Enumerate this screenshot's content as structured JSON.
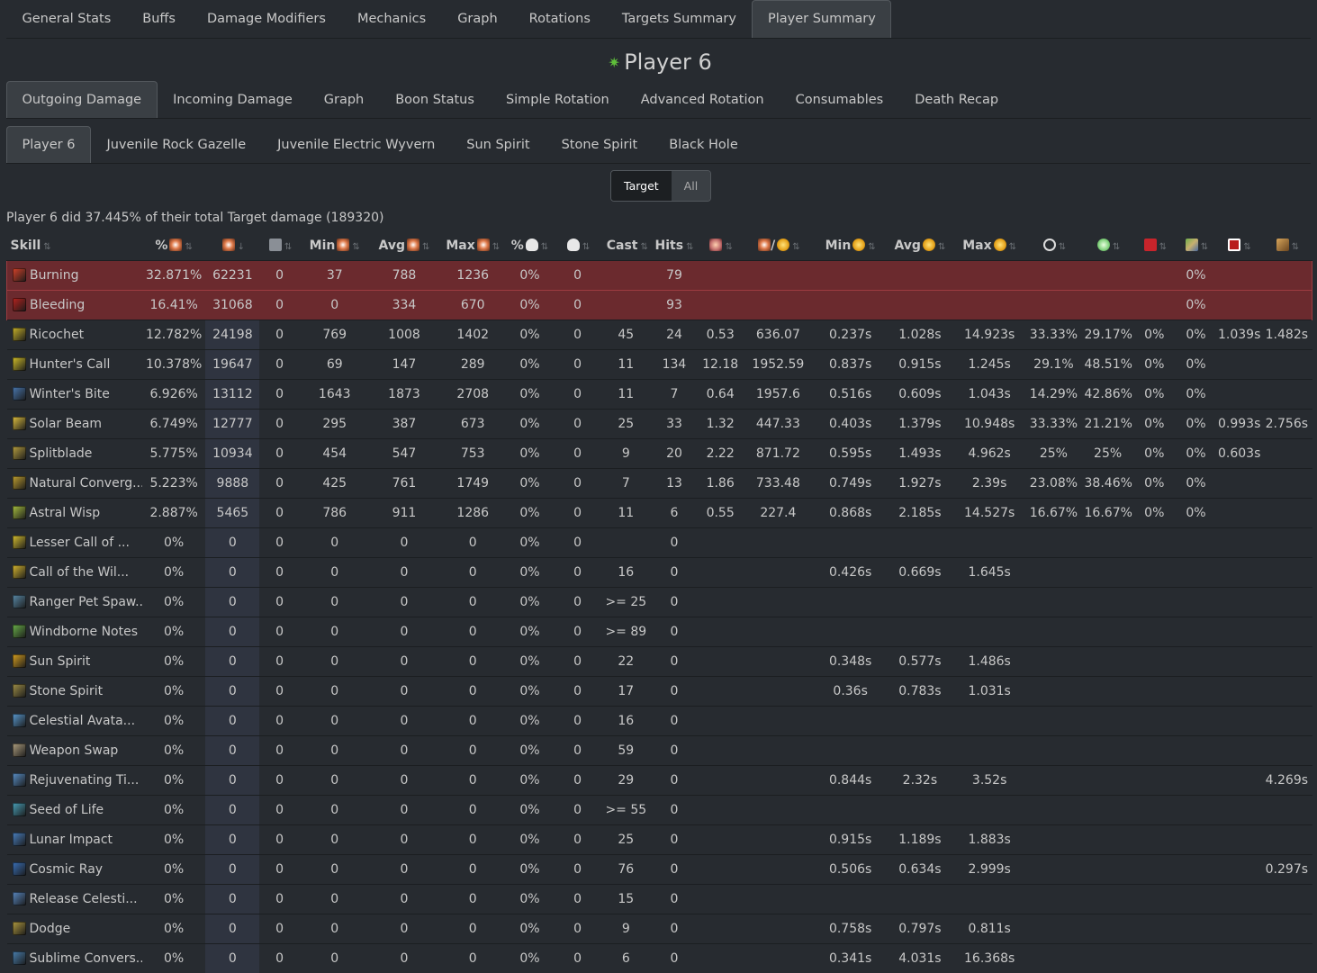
{
  "main_tabs": [
    "General Stats",
    "Buffs",
    "Damage Modifiers",
    "Mechanics",
    "Graph",
    "Rotations",
    "Targets Summary",
    "Player Summary"
  ],
  "main_active": 7,
  "player_title": "Player 6",
  "sub_tabs": [
    "Outgoing Damage",
    "Incoming Damage",
    "Graph",
    "Boon Status",
    "Simple Rotation",
    "Advanced Rotation",
    "Consumables",
    "Death Recap"
  ],
  "sub_active": 0,
  "target_tabs": [
    "Player 6",
    "Juvenile Rock Gazelle",
    "Juvenile Electric Wyvern",
    "Sun Spirit",
    "Stone Spirit",
    "Black Hole"
  ],
  "target_active": 0,
  "toggle": {
    "target": "Target",
    "all": "All"
  },
  "summary_text": "Player 6 did 37.445% of their total Target damage (189320)",
  "columns": [
    {
      "label": "Skill",
      "icon": null
    },
    {
      "label": "%",
      "icon": "damage-icon"
    },
    {
      "label": "",
      "icon": "damage-icon"
    },
    {
      "label": "",
      "icon": "barrier-icon"
    },
    {
      "label": "Min",
      "icon": "damage-icon"
    },
    {
      "label": "Avg",
      "icon": "damage-icon"
    },
    {
      "label": "Max",
      "icon": "damage-icon"
    },
    {
      "label": "%",
      "icon": "critical-icon"
    },
    {
      "label": "",
      "icon": "critical-icon"
    },
    {
      "label": "Cast",
      "icon": null
    },
    {
      "label": "Hits",
      "icon": null
    },
    {
      "label": "",
      "icon": "hits-per-cast-icon"
    },
    {
      "label": "/",
      "icon": "damage-per-time-icon"
    },
    {
      "label": "Min",
      "icon": "time-icon"
    },
    {
      "label": "Avg",
      "icon": "time-icon"
    },
    {
      "label": "Max",
      "icon": "time-icon"
    },
    {
      "label": "",
      "icon": "flanking-icon"
    },
    {
      "label": "",
      "icon": "glance-icon"
    },
    {
      "label": "",
      "icon": "against-moving-icon"
    },
    {
      "label": "",
      "icon": "interrupted-icon"
    },
    {
      "label": "",
      "icon": "wasted-icon"
    },
    {
      "label": "",
      "icon": "saved-icon"
    }
  ],
  "rows": [
    {
      "name": "Burning",
      "cond": true,
      "color": "#d8422a",
      "v": [
        "32.871%",
        "62231",
        "0",
        "37",
        "788",
        "1236",
        "0%",
        "0",
        "",
        "79",
        "",
        "",
        "",
        "",
        "",
        "",
        "",
        "",
        "0%",
        "",
        ""
      ]
    },
    {
      "name": "Bleeding",
      "cond": true,
      "color": "#b8231f",
      "v": [
        "16.41%",
        "31068",
        "0",
        "0",
        "334",
        "670",
        "0%",
        "0",
        "",
        "93",
        "",
        "",
        "",
        "",
        "",
        "",
        "",
        "",
        "0%",
        "",
        ""
      ]
    },
    {
      "name": "Ricochet",
      "cond": false,
      "color": "#c9b32a",
      "v": [
        "12.782%",
        "24198",
        "0",
        "769",
        "1008",
        "1402",
        "0%",
        "0",
        "45",
        "24",
        "0.53",
        "636.07",
        "0.237s",
        "1.028s",
        "14.923s",
        "33.33%",
        "29.17%",
        "0%",
        "0%",
        "1.039s",
        "1.482s"
      ]
    },
    {
      "name": "Hunter's Call",
      "cond": false,
      "color": "#d4c02a",
      "v": [
        "10.378%",
        "19647",
        "0",
        "69",
        "147",
        "289",
        "0%",
        "0",
        "11",
        "134",
        "12.18",
        "1952.59",
        "0.837s",
        "0.915s",
        "1.245s",
        "29.1%",
        "48.51%",
        "0%",
        "0%",
        "",
        ""
      ]
    },
    {
      "name": "Winter's Bite",
      "cond": false,
      "color": "#4a78b0",
      "v": [
        "6.926%",
        "13112",
        "0",
        "1643",
        "1873",
        "2708",
        "0%",
        "0",
        "11",
        "7",
        "0.64",
        "1957.6",
        "0.516s",
        "0.609s",
        "1.043s",
        "14.29%",
        "42.86%",
        "0%",
        "0%",
        "",
        ""
      ]
    },
    {
      "name": "Solar Beam",
      "cond": false,
      "color": "#e0c040",
      "v": [
        "6.749%",
        "12777",
        "0",
        "295",
        "387",
        "673",
        "0%",
        "0",
        "25",
        "33",
        "1.32",
        "447.33",
        "0.403s",
        "1.379s",
        "10.948s",
        "33.33%",
        "21.21%",
        "0%",
        "0%",
        "0.993s",
        "2.756s"
      ]
    },
    {
      "name": "Splitblade",
      "cond": false,
      "color": "#b8a040",
      "v": [
        "5.775%",
        "10934",
        "0",
        "454",
        "547",
        "753",
        "0%",
        "0",
        "9",
        "20",
        "2.22",
        "871.72",
        "0.595s",
        "1.493s",
        "4.962s",
        "25%",
        "25%",
        "0%",
        "0%",
        "0.603s",
        ""
      ]
    },
    {
      "name": "Natural Converg...",
      "cond": false,
      "color": "#c0a030",
      "v": [
        "5.223%",
        "9888",
        "0",
        "425",
        "761",
        "1749",
        "0%",
        "0",
        "7",
        "13",
        "1.86",
        "733.48",
        "0.749s",
        "1.927s",
        "2.39s",
        "23.08%",
        "38.46%",
        "0%",
        "0%",
        "",
        ""
      ]
    },
    {
      "name": "Astral Wisp",
      "cond": false,
      "color": "#a8c040",
      "v": [
        "2.887%",
        "5465",
        "0",
        "786",
        "911",
        "1286",
        "0%",
        "0",
        "11",
        "6",
        "0.55",
        "227.4",
        "0.868s",
        "2.185s",
        "14.527s",
        "16.67%",
        "16.67%",
        "0%",
        "0%",
        "",
        ""
      ]
    },
    {
      "name": "Lesser Call of ...",
      "cond": false,
      "color": "#d8c030",
      "v": [
        "0%",
        "0",
        "0",
        "0",
        "0",
        "0",
        "0%",
        "0",
        "",
        "0",
        "",
        "",
        "",
        "",
        "",
        "",
        "",
        "",
        "",
        "",
        ""
      ]
    },
    {
      "name": "Call of the Wil...",
      "cond": false,
      "color": "#d8b830",
      "v": [
        "0%",
        "0",
        "0",
        "0",
        "0",
        "0",
        "0%",
        "0",
        "16",
        "0",
        "",
        "",
        "0.426s",
        "0.669s",
        "1.645s",
        "",
        "",
        "",
        "",
        "",
        ""
      ]
    },
    {
      "name": "Ranger Pet Spaw...",
      "cond": false,
      "color": "#5a8aa8",
      "v": [
        "0%",
        "0",
        "0",
        "0",
        "0",
        "0",
        "0%",
        "0",
        ">= 25",
        "0",
        "",
        "",
        "",
        "",
        "",
        "",
        "",
        "",
        "",
        "",
        ""
      ]
    },
    {
      "name": "Windborne Notes",
      "cond": false,
      "color": "#6ab04a",
      "v": [
        "0%",
        "0",
        "0",
        "0",
        "0",
        "0",
        "0%",
        "0",
        ">= 89",
        "0",
        "",
        "",
        "",
        "",
        "",
        "",
        "",
        "",
        "",
        "",
        ""
      ]
    },
    {
      "name": "Sun Spirit",
      "cond": false,
      "color": "#d8a020",
      "v": [
        "0%",
        "0",
        "0",
        "0",
        "0",
        "0",
        "0%",
        "0",
        "22",
        "0",
        "",
        "",
        "0.348s",
        "0.577s",
        "1.486s",
        "",
        "",
        "",
        "",
        "",
        ""
      ]
    },
    {
      "name": "Stone Spirit",
      "cond": false,
      "color": "#a09048",
      "v": [
        "0%",
        "0",
        "0",
        "0",
        "0",
        "0",
        "0%",
        "0",
        "17",
        "0",
        "",
        "",
        "0.36s",
        "0.783s",
        "1.031s",
        "",
        "",
        "",
        "",
        "",
        ""
      ]
    },
    {
      "name": "Celestial Avata...",
      "cond": false,
      "color": "#5a9ad0",
      "v": [
        "0%",
        "0",
        "0",
        "0",
        "0",
        "0",
        "0%",
        "0",
        "16",
        "0",
        "",
        "",
        "",
        "",
        "",
        "",
        "",
        "",
        "",
        "",
        ""
      ]
    },
    {
      "name": "Weapon Swap",
      "cond": false,
      "color": "#b0a080",
      "v": [
        "0%",
        "0",
        "0",
        "0",
        "0",
        "0",
        "0%",
        "0",
        "59",
        "0",
        "",
        "",
        "",
        "",
        "",
        "",
        "",
        "",
        "",
        "",
        ""
      ]
    },
    {
      "name": "Rejuvenating Ti...",
      "cond": false,
      "color": "#5a90c8",
      "v": [
        "0%",
        "0",
        "0",
        "0",
        "0",
        "0",
        "0%",
        "0",
        "29",
        "0",
        "",
        "",
        "0.844s",
        "2.32s",
        "3.52s",
        "",
        "",
        "",
        "",
        "",
        "4.269s"
      ]
    },
    {
      "name": "Seed of Life",
      "cond": false,
      "color": "#4aa0b8",
      "v": [
        "0%",
        "0",
        "0",
        "0",
        "0",
        "0",
        "0%",
        "0",
        ">= 55",
        "0",
        "",
        "",
        "",
        "",
        "",
        "",
        "",
        "",
        "",
        "",
        ""
      ]
    },
    {
      "name": "Lunar Impact",
      "cond": false,
      "color": "#4a80c0",
      "v": [
        "0%",
        "0",
        "0",
        "0",
        "0",
        "0",
        "0%",
        "0",
        "25",
        "0",
        "",
        "",
        "0.915s",
        "1.189s",
        "1.883s",
        "",
        "",
        "",
        "",
        "",
        ""
      ]
    },
    {
      "name": "Cosmic Ray",
      "cond": false,
      "color": "#3a70b8",
      "v": [
        "0%",
        "0",
        "0",
        "0",
        "0",
        "0",
        "0%",
        "0",
        "76",
        "0",
        "",
        "",
        "0.506s",
        "0.634s",
        "2.999s",
        "",
        "",
        "",
        "",
        "",
        "0.297s"
      ]
    },
    {
      "name": "Release Celesti...",
      "cond": false,
      "color": "#5a88c0",
      "v": [
        "0%",
        "0",
        "0",
        "0",
        "0",
        "0",
        "0%",
        "0",
        "15",
        "0",
        "",
        "",
        "",
        "",
        "",
        "",
        "",
        "",
        "",
        "",
        ""
      ]
    },
    {
      "name": "Dodge",
      "cond": false,
      "color": "#b09a40",
      "v": [
        "0%",
        "0",
        "0",
        "0",
        "0",
        "0",
        "0%",
        "0",
        "9",
        "0",
        "",
        "",
        "0.758s",
        "0.797s",
        "0.811s",
        "",
        "",
        "",
        "",
        "",
        ""
      ]
    },
    {
      "name": "Sublime Convers...",
      "cond": false,
      "color": "#4a80b0",
      "v": [
        "0%",
        "0",
        "0",
        "0",
        "0",
        "0",
        "0%",
        "0",
        "6",
        "0",
        "",
        "",
        "0.341s",
        "4.031s",
        "16.368s",
        "",
        "",
        "",
        "",
        "",
        ""
      ]
    }
  ]
}
